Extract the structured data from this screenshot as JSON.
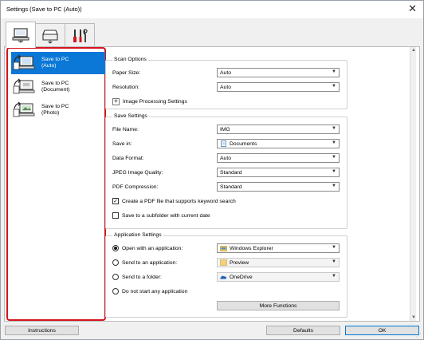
{
  "window": {
    "title": "Settings (Save to PC (Auto))",
    "close_glyph": "✕"
  },
  "tabs": [
    {
      "icon": "scan-from-computer-icon",
      "active": true
    },
    {
      "icon": "scan-from-panel-icon",
      "active": false
    },
    {
      "icon": "general-settings-tools-icon",
      "active": false
    }
  ],
  "left_panel": {
    "items": [
      {
        "label_line1": "Save to PC",
        "label_line2": "(Auto)",
        "selected": true
      },
      {
        "label_line1": "Save to PC",
        "label_line2": "(Document)",
        "selected": false
      },
      {
        "label_line1": "Save to PC",
        "label_line2": "(Photo)",
        "selected": false
      }
    ]
  },
  "scan_options": {
    "legend": "Scan Options",
    "paper_size_label": "Paper Size:",
    "paper_size_value": "Auto",
    "resolution_label": "Resolution:",
    "resolution_value": "Auto",
    "image_processing_label": "Image Processing Settings",
    "expand_glyph": "+"
  },
  "save_settings": {
    "legend": "Save Settings",
    "file_name_label": "File Name:",
    "file_name_value": "IMG",
    "save_in_label": "Save in:",
    "save_in_value": "Documents",
    "data_format_label": "Data Format:",
    "data_format_value": "Auto",
    "jpeg_quality_label": "JPEG Image Quality:",
    "jpeg_quality_value": "Standard",
    "pdf_compression_label": "PDF Compression:",
    "pdf_compression_value": "Standard",
    "keyword_pdf_label": "Create a PDF file that supports keyword search",
    "keyword_pdf_checked": true,
    "check_glyph": "✓",
    "subfolder_label": "Save to a subfolder with current date",
    "subfolder_checked": false
  },
  "application_settings": {
    "legend": "Application Settings",
    "open_app_label": "Open with an application:",
    "open_app_value": "Windows Explorer",
    "send_app_label": "Send to an application:",
    "send_app_value": "Preview",
    "send_folder_label": "Send to a folder:",
    "send_folder_value": "OneDrive",
    "no_app_label": "Do not start any application",
    "selected_option": "open_app",
    "more_functions_label": "More Functions"
  },
  "footer": {
    "instructions_label": "Instructions",
    "defaults_label": "Defaults",
    "ok_label": "OK"
  },
  "colors": {
    "selection_blue": "#0b78d7",
    "highlight_red": "#d5141c"
  }
}
